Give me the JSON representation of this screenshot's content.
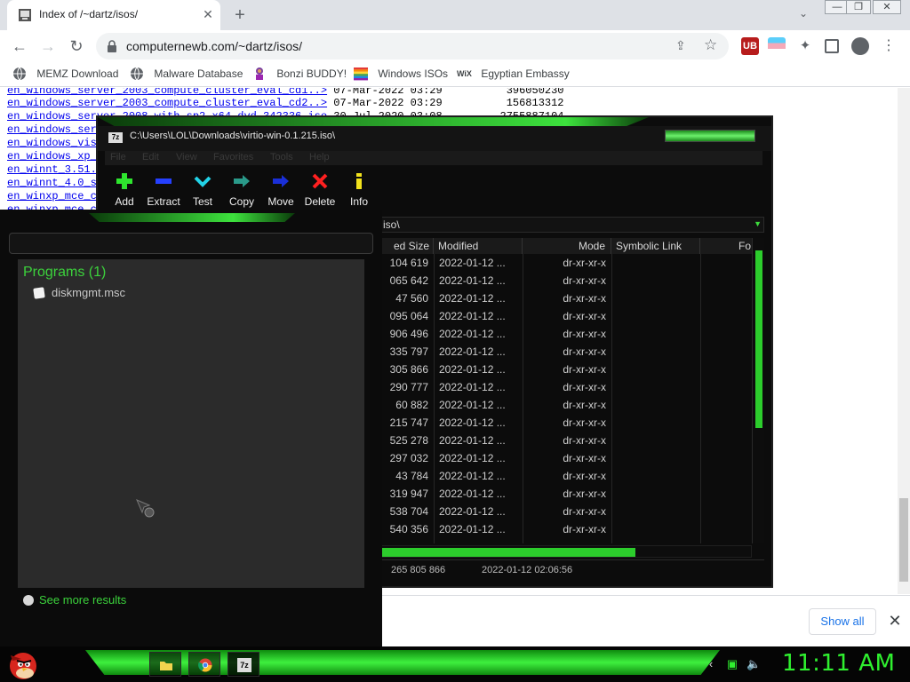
{
  "browser": {
    "tab_title": "Index of /~dartz/isos/",
    "tab_close": "✕",
    "new_tab": "+",
    "url": "computernewb.com/~dartz/isos/",
    "bookmarks": [
      {
        "label": "MEMZ Download",
        "icon": "globe-icon"
      },
      {
        "label": "Malware Database",
        "icon": "globe-icon"
      },
      {
        "label": "Bonzi BUDDY!",
        "icon": "bonzi-icon"
      },
      {
        "label": "Windows ISOs",
        "icon": "windows-flag-icon"
      },
      {
        "label": "Egyptian Embassy",
        "icon": "wix-icon"
      }
    ],
    "wix_text": "WiX",
    "ext_ublock": "UB"
  },
  "listing": {
    "lines": [
      {
        "name": "en_windows_server_2003_compute_cluster_eval_cd1..>",
        "rest": " 07-Mar-2022 03:29          396050230"
      },
      {
        "name": "en_windows_server_2003_compute_cluster_eval_cd2..>",
        "rest": " 07-Mar-2022 03:29          156813312"
      },
      {
        "name": "en_windows_server_2008_with_sp2_x64_dvd_342336.iso",
        "rest": " 30-Jul-2020 03:08         2755887104"
      },
      {
        "name": "en_windows_ser",
        "rest": ""
      },
      {
        "name": "en_windows_vis",
        "rest": ""
      },
      {
        "name": "en_windows_xp_",
        "rest": ""
      },
      {
        "name": "en_winnt_3.51.",
        "rest": ""
      },
      {
        "name": "en_winnt_4.0_s",
        "rest": ""
      },
      {
        "name": "en_winxp_mce_c",
        "rest": ""
      },
      {
        "name": "en_winxp_mce_c",
        "rest": ""
      }
    ]
  },
  "download_bar": {
    "show_all": "Show all",
    "close": "✕"
  },
  "sevenzip": {
    "logo": "7z",
    "title": "C:\\Users\\LOL\\Downloads\\virtio-win-0.1.215.iso\\",
    "menu": [
      "File",
      "Edit",
      "View",
      "Favorites",
      "Tools",
      "Help"
    ],
    "toolbar": [
      {
        "label": "Add",
        "icon": "add-icon",
        "color": "#2ee62e"
      },
      {
        "label": "Extract",
        "icon": "extract-icon",
        "color": "#2540ff"
      },
      {
        "label": "Test",
        "icon": "test-icon",
        "color": "#22d3e8"
      },
      {
        "label": "Copy",
        "icon": "copy-icon",
        "color": "#2a9a8a"
      },
      {
        "label": "Move",
        "icon": "move-icon",
        "color": "#1a2fd8"
      },
      {
        "label": "Delete",
        "icon": "delete-icon",
        "color": "#ff2020"
      },
      {
        "label": "Info",
        "icon": "info-icon",
        "color": "#f2e21c"
      }
    ],
    "address": "iso\\",
    "columns": [
      "ed Size",
      "Modified",
      "Mode",
      "Symbolic Link",
      "Fo"
    ],
    "rows": [
      {
        "size": "104 619",
        "modified": "2022-01-12 ...",
        "mode": "dr-xr-xr-x"
      },
      {
        "size": "065 642",
        "modified": "2022-01-12 ...",
        "mode": "dr-xr-xr-x"
      },
      {
        "size": "47 560",
        "modified": "2022-01-12 ...",
        "mode": "dr-xr-xr-x"
      },
      {
        "size": "095 064",
        "modified": "2022-01-12 ...",
        "mode": "dr-xr-xr-x"
      },
      {
        "size": "906 496",
        "modified": "2022-01-12 ...",
        "mode": "dr-xr-xr-x"
      },
      {
        "size": "335 797",
        "modified": "2022-01-12 ...",
        "mode": "dr-xr-xr-x"
      },
      {
        "size": "305 866",
        "modified": "2022-01-12 ...",
        "mode": "dr-xr-xr-x"
      },
      {
        "size": "290 777",
        "modified": "2022-01-12 ...",
        "mode": "dr-xr-xr-x"
      },
      {
        "size": "60 882",
        "modified": "2022-01-12 ...",
        "mode": "dr-xr-xr-x"
      },
      {
        "size": "215 747",
        "modified": "2022-01-12 ...",
        "mode": "dr-xr-xr-x"
      },
      {
        "size": "525 278",
        "modified": "2022-01-12 ...",
        "mode": "dr-xr-xr-x"
      },
      {
        "size": "297 032",
        "modified": "2022-01-12 ...",
        "mode": "dr-xr-xr-x"
      },
      {
        "size": "43 784",
        "modified": "2022-01-12 ...",
        "mode": "dr-xr-xr-x"
      },
      {
        "size": "319 947",
        "modified": "2022-01-12 ...",
        "mode": "dr-xr-xr-x"
      },
      {
        "size": "538 704",
        "modified": "2022-01-12 ...",
        "mode": "dr-xr-xr-x"
      },
      {
        "size": "540 356",
        "modified": "2022-01-12 ...",
        "mode": "dr-xr-xr-x"
      }
    ],
    "status": {
      "size": "265 805 866",
      "modified": "2022-01-12 02:06:56"
    }
  },
  "start_menu": {
    "programs_header": "Programs (1)",
    "result": "diskmgmt.msc",
    "see_more": "See more results"
  },
  "taskbar": {
    "clock": "11:11 AM",
    "apps": [
      "folder-icon",
      "chrome-icon",
      "sevenzip-icon"
    ],
    "sevenzip_glyph": "7z"
  },
  "colors": {
    "accent_green": "#3de23d",
    "link_blue": "#0000ee",
    "chrome_blue": "#1a73e8"
  }
}
